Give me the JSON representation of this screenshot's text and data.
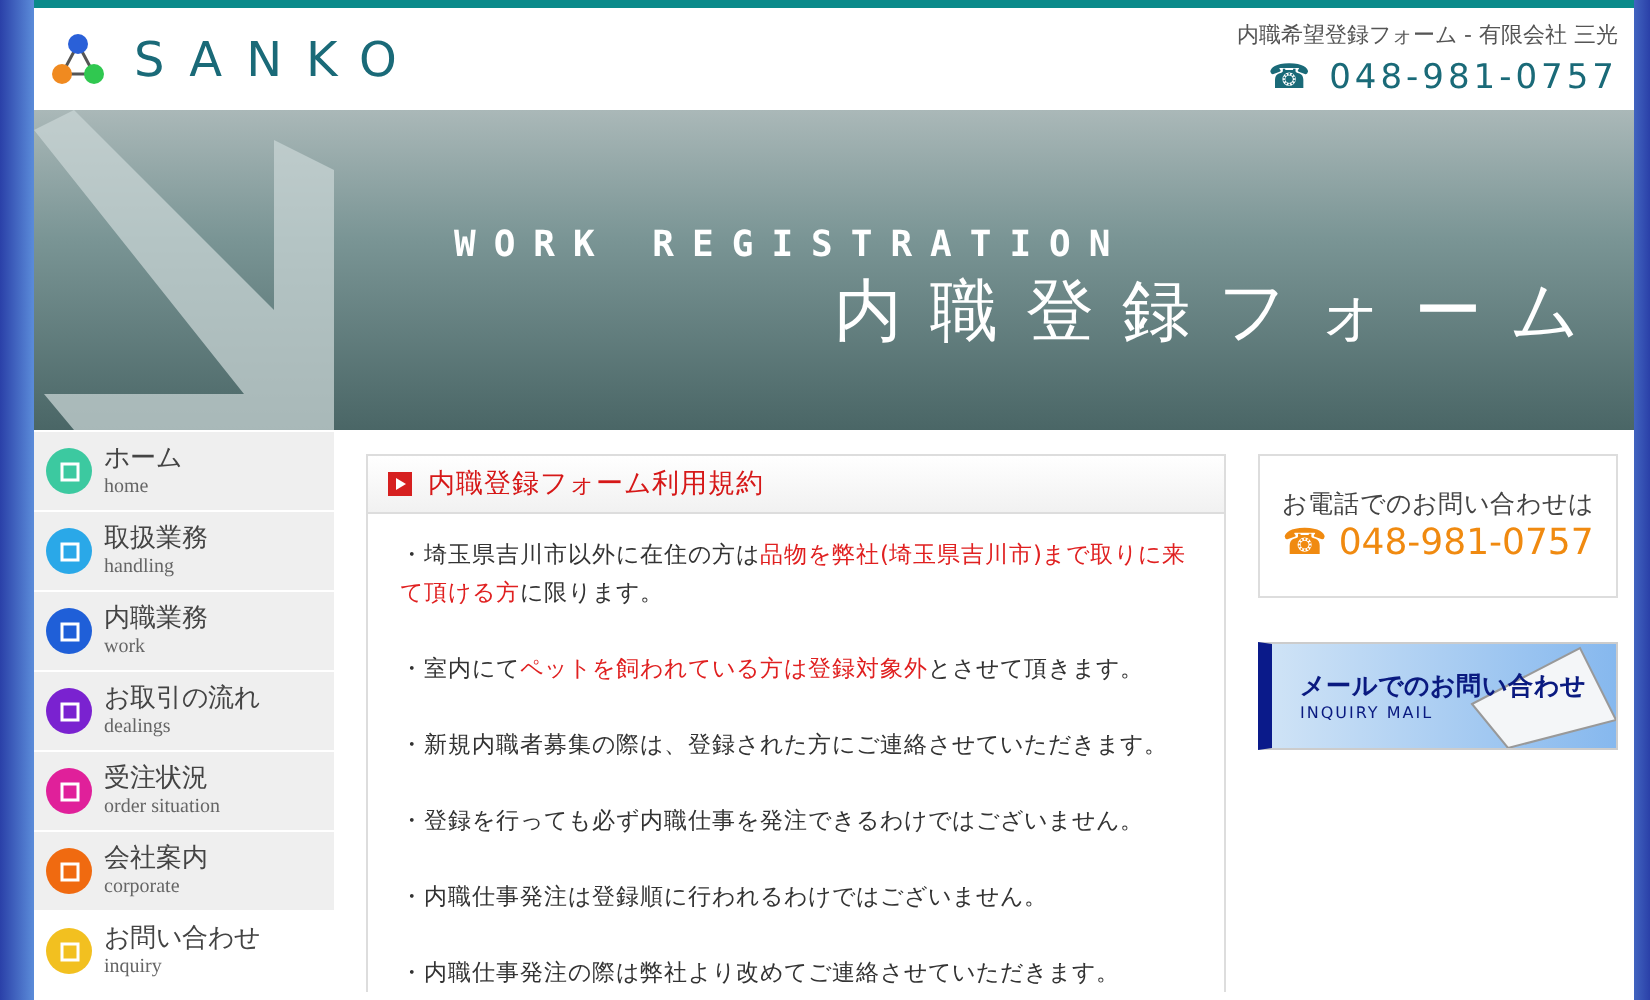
{
  "header": {
    "logo": "SANKO",
    "tagline": "内職希望登録フォーム - 有限会社 三光",
    "phone_icon": "☎",
    "phone": "048-981-0757"
  },
  "banner": {
    "subtitle": "WORK REGISTRATION",
    "title": "内職登録フォーム"
  },
  "nav": [
    {
      "label": "ホーム",
      "sub": "home",
      "color": "#3cc9a0",
      "selected": false
    },
    {
      "label": "取扱業務",
      "sub": "handling",
      "color": "#2aa8e8",
      "selected": false
    },
    {
      "label": "内職業務",
      "sub": "work",
      "color": "#1f5fd8",
      "selected": false
    },
    {
      "label": "お取引の流れ",
      "sub": "dealings",
      "color": "#7a22d0",
      "selected": false
    },
    {
      "label": "受注状況",
      "sub": "order situation",
      "color": "#e0209a",
      "selected": false
    },
    {
      "label": "会社案内",
      "sub": "corporate",
      "color": "#f06a10",
      "selected": false
    },
    {
      "label": "お問い合わせ",
      "sub": "inquiry",
      "color": "#f2c020",
      "selected": true
    }
  ],
  "terms": {
    "title": "内職登録フォーム利用規約",
    "items": [
      [
        {
          "text": "・埼玉県吉川市以外に在住の方は",
          "highlight": false
        },
        {
          "text": "品物を弊社(埼玉県吉川市)まで取りに来て頂ける方",
          "highlight": true
        },
        {
          "text": "に限ります。",
          "highlight": false
        }
      ],
      [
        {
          "text": "・室内にて",
          "highlight": false
        },
        {
          "text": "ペットを飼われている方は登録対象外",
          "highlight": true
        },
        {
          "text": "とさせて頂きます。",
          "highlight": false
        }
      ],
      [
        {
          "text": "・新規内職者募集の際は、登録された方にご連絡させていただきます。",
          "highlight": false
        }
      ],
      [
        {
          "text": "・登録を行っても必ず内職仕事を発注できるわけではございません。",
          "highlight": false
        }
      ],
      [
        {
          "text": "・内職仕事発注は登録順に行われるわけではございません。",
          "highlight": false
        }
      ],
      [
        {
          "text": "・内職仕事発注の際は弊社より改めてご連絡させていただきます。",
          "highlight": false
        }
      ]
    ]
  },
  "contact": {
    "label": "お電話でのお問い合わせは",
    "phone_icon": "☎",
    "phone": "048-981-0757"
  },
  "mail_banner": {
    "title": "メールでのお問い合わせ",
    "subtitle": "INQUIRY MAIL"
  }
}
